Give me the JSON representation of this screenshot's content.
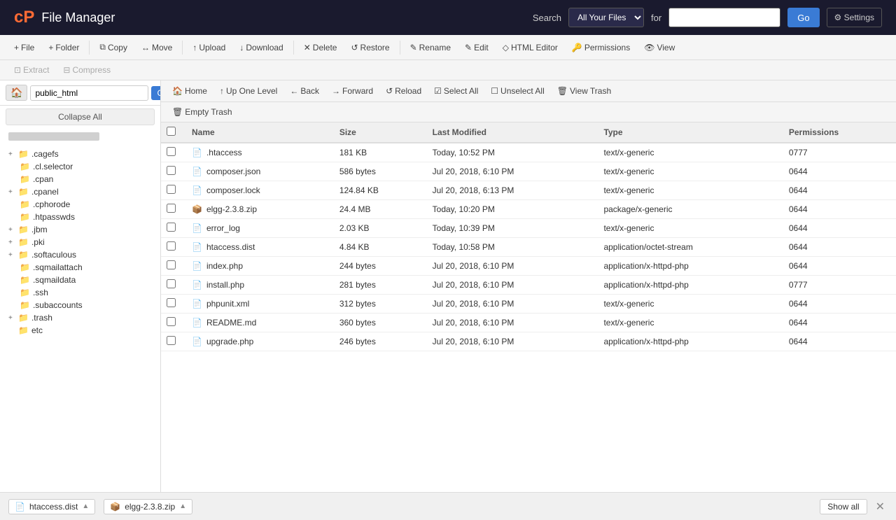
{
  "header": {
    "logo": "cP",
    "title": "File Manager",
    "search_label": "Search",
    "search_options": [
      "All Your Files"
    ],
    "search_selected": "All Your Files",
    "for_label": "for",
    "search_placeholder": "",
    "go_label": "Go",
    "settings_label": "⚙ Settings"
  },
  "toolbar": {
    "buttons": [
      {
        "id": "new-file",
        "icon": "+",
        "label": "File"
      },
      {
        "id": "new-folder",
        "icon": "+",
        "label": "Folder"
      },
      {
        "id": "copy",
        "icon": "⧉",
        "label": "Copy"
      },
      {
        "id": "move",
        "icon": "→",
        "label": "Move"
      },
      {
        "id": "upload",
        "icon": "↑",
        "label": "Upload"
      },
      {
        "id": "download",
        "icon": "↓",
        "label": "Download"
      },
      {
        "id": "delete",
        "icon": "✕",
        "label": "Delete"
      },
      {
        "id": "restore",
        "icon": "↺",
        "label": "Restore"
      },
      {
        "id": "rename",
        "icon": "✎",
        "label": "Rename"
      },
      {
        "id": "edit",
        "icon": "✎",
        "label": "Edit"
      },
      {
        "id": "html-editor",
        "icon": "◇",
        "label": "HTML Editor"
      },
      {
        "id": "permissions",
        "icon": "🔑",
        "label": "Permissions"
      },
      {
        "id": "view",
        "icon": "👁",
        "label": "View"
      }
    ],
    "row2": [
      {
        "id": "extract",
        "icon": "⊡",
        "label": "Extract"
      },
      {
        "id": "compress",
        "icon": "⊟",
        "label": "Compress"
      }
    ]
  },
  "sidebar": {
    "path_value": "public_html",
    "go_label": "Go",
    "collapse_all_label": "Collapse All",
    "items": [
      {
        "id": "cagefs",
        "label": ".cagefs",
        "indent": 0,
        "expandable": true,
        "expanded": false
      },
      {
        "id": "cl-selector",
        "label": ".cl.selector",
        "indent": 1,
        "expandable": false
      },
      {
        "id": "cpan",
        "label": ".cpan",
        "indent": 1,
        "expandable": false
      },
      {
        "id": "cpanel",
        "label": ".cpanel",
        "indent": 0,
        "expandable": true,
        "expanded": false
      },
      {
        "id": "cphorode",
        "label": ".cphorode",
        "indent": 1,
        "expandable": false
      },
      {
        "id": "htpasswds",
        "label": ".htpasswds",
        "indent": 1,
        "expandable": false
      },
      {
        "id": "jbm",
        "label": ".jbm",
        "indent": 0,
        "expandable": true,
        "expanded": false
      },
      {
        "id": "pki",
        "label": ".pki",
        "indent": 0,
        "expandable": true,
        "expanded": false
      },
      {
        "id": "softaculous",
        "label": ".softaculous",
        "indent": 0,
        "expandable": true,
        "expanded": false
      },
      {
        "id": "sqmailattach",
        "label": ".sqmailattach",
        "indent": 1,
        "expandable": false
      },
      {
        "id": "sqmaildata",
        "label": ".sqmaildata",
        "indent": 1,
        "expandable": false
      },
      {
        "id": "ssh",
        "label": ".ssh",
        "indent": 1,
        "expandable": false
      },
      {
        "id": "subaccounts",
        "label": ".subaccounts",
        "indent": 1,
        "expandable": false
      },
      {
        "id": "trash",
        "label": ".trash",
        "indent": 0,
        "expandable": true,
        "expanded": false
      },
      {
        "id": "etc",
        "label": "etc",
        "indent": 0,
        "expandable": false
      }
    ]
  },
  "file_panel": {
    "toolbar": [
      {
        "id": "home",
        "icon": "🏠",
        "label": "Home"
      },
      {
        "id": "up-one-level",
        "icon": "↑",
        "label": "Up One Level"
      },
      {
        "id": "back",
        "icon": "←",
        "label": "Back"
      },
      {
        "id": "forward",
        "icon": "→",
        "label": "Forward"
      },
      {
        "id": "reload",
        "icon": "↺",
        "label": "Reload"
      },
      {
        "id": "select-all",
        "icon": "☑",
        "label": "Select All"
      },
      {
        "id": "unselect-all",
        "icon": "☐",
        "label": "Unselect All"
      },
      {
        "id": "view-trash",
        "icon": "🗑",
        "label": "View Trash"
      }
    ],
    "toolbar2": [
      {
        "id": "empty-trash",
        "icon": "🗑",
        "label": "Empty Trash"
      }
    ],
    "columns": [
      "Name",
      "Size",
      "Last Modified",
      "Type",
      "Permissions"
    ],
    "files": [
      {
        "name": ".htaccess",
        "size": "181 KB",
        "modified": "Today, 10:52 PM",
        "type": "text/x-generic",
        "permissions": "0777",
        "icon_type": "generic"
      },
      {
        "name": "composer.json",
        "size": "586 bytes",
        "modified": "Jul 20, 2018, 6:10 PM",
        "type": "text/x-generic",
        "permissions": "0644",
        "icon_type": "generic"
      },
      {
        "name": "composer.lock",
        "size": "124.84 KB",
        "modified": "Jul 20, 2018, 6:13 PM",
        "type": "text/x-generic",
        "permissions": "0644",
        "icon_type": "generic"
      },
      {
        "name": "elgg-2.3.8.zip",
        "size": "24.4 MB",
        "modified": "Today, 10:20 PM",
        "type": "package/x-generic",
        "permissions": "0644",
        "icon_type": "zip"
      },
      {
        "name": "error_log",
        "size": "2.03 KB",
        "modified": "Today, 10:39 PM",
        "type": "text/x-generic",
        "permissions": "0644",
        "icon_type": "generic"
      },
      {
        "name": "htaccess.dist",
        "size": "4.84 KB",
        "modified": "Today, 10:58 PM",
        "type": "application/octet-stream",
        "permissions": "0644",
        "icon_type": "generic"
      },
      {
        "name": "index.php",
        "size": "244 bytes",
        "modified": "Jul 20, 2018, 6:10 PM",
        "type": "application/x-httpd-php",
        "permissions": "0644",
        "icon_type": "php"
      },
      {
        "name": "install.php",
        "size": "281 bytes",
        "modified": "Jul 20, 2018, 6:10 PM",
        "type": "application/x-httpd-php",
        "permissions": "0777",
        "icon_type": "php"
      },
      {
        "name": "phpunit.xml",
        "size": "312 bytes",
        "modified": "Jul 20, 2018, 6:10 PM",
        "type": "text/x-generic",
        "permissions": "0644",
        "icon_type": "generic"
      },
      {
        "name": "README.md",
        "size": "360 bytes",
        "modified": "Jul 20, 2018, 6:10 PM",
        "type": "text/x-generic",
        "permissions": "0644",
        "icon_type": "generic"
      },
      {
        "name": "upgrade.php",
        "size": "246 bytes",
        "modified": "Jul 20, 2018, 6:10 PM",
        "type": "application/x-httpd-php",
        "permissions": "0644",
        "icon_type": "php"
      }
    ]
  },
  "bottom_bar": {
    "items": [
      {
        "id": "htaccess-item",
        "icon": "📄",
        "label": "htaccess.dist",
        "arrow": "▲"
      },
      {
        "id": "elgg-item",
        "icon_emoji": "📦",
        "label": "elgg-2.3.8.zip",
        "arrow": "▲"
      }
    ],
    "show_all_label": "Show all",
    "close_icon": "✕"
  }
}
